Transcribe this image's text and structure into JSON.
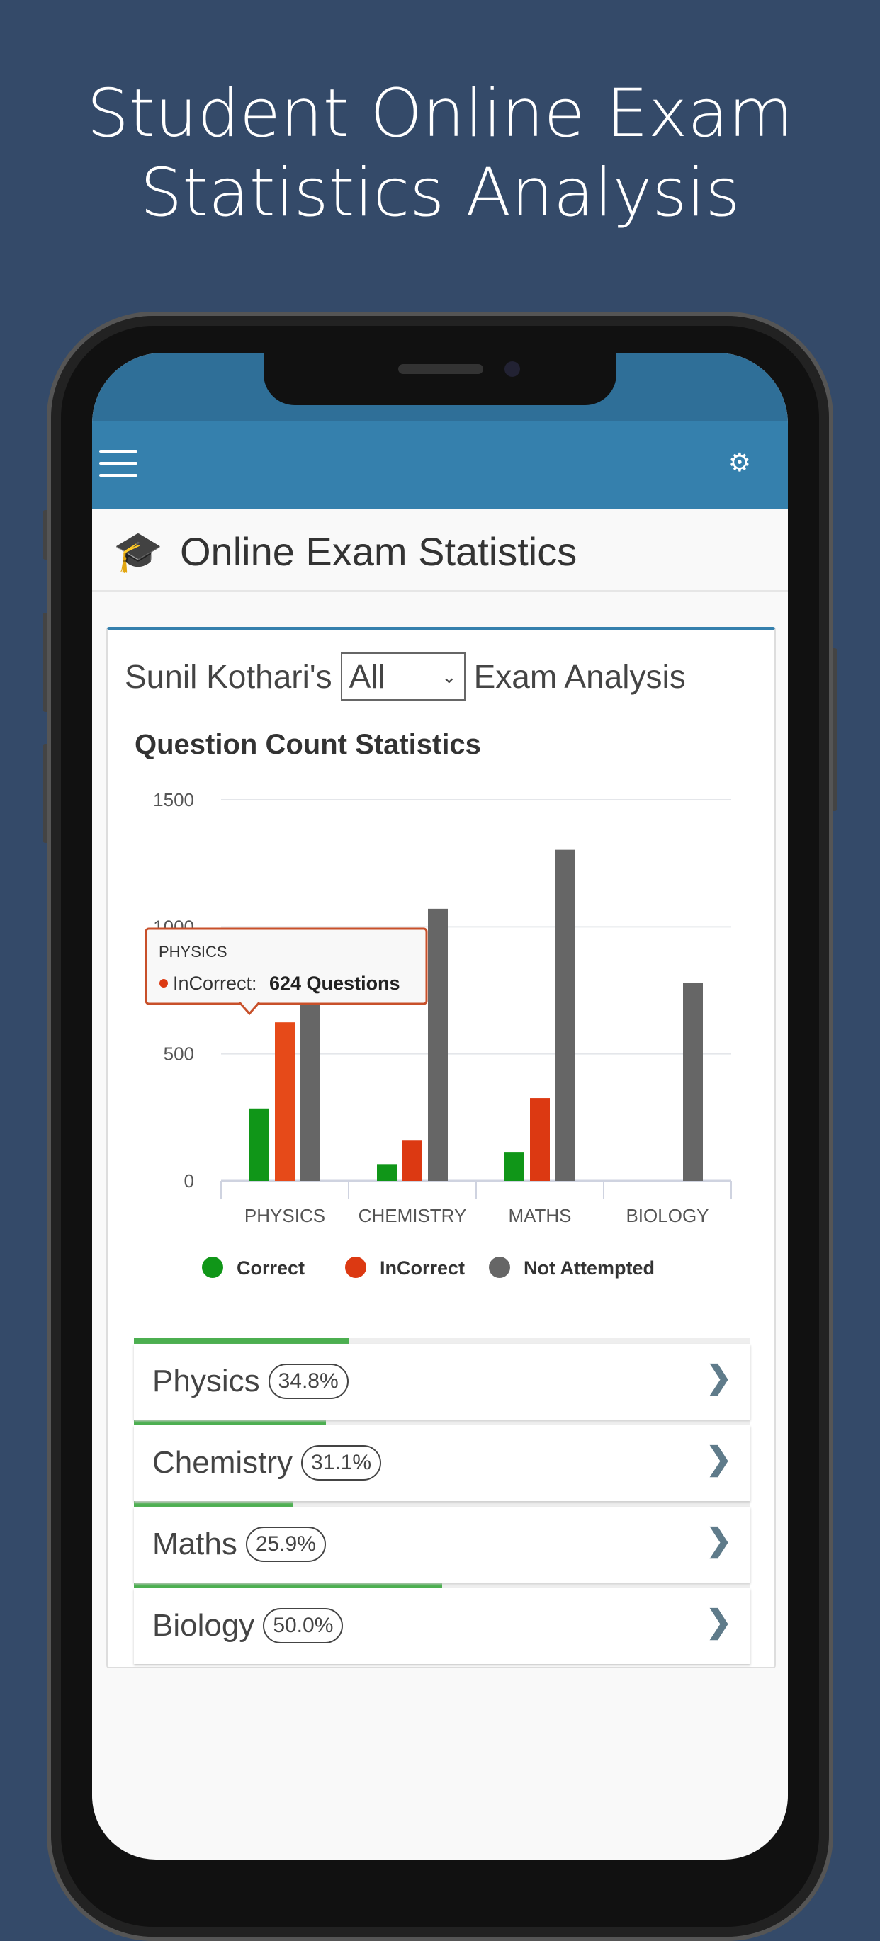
{
  "hero": {
    "line1": "Student Online Exam",
    "line2": "Statistics Analysis"
  },
  "toolbar": {
    "menu_icon": "hamburger-icon",
    "settings_icon": "gears-icon"
  },
  "page": {
    "title": "Online Exam Statistics",
    "icon": "graduation-cap-icon"
  },
  "analysis": {
    "prefix": "Sunil Kothari's",
    "select_value": "All",
    "suffix": "Exam Analysis"
  },
  "chart_data": {
    "type": "bar",
    "title": "Question Count Statistics",
    "categories": [
      "PHYSICS",
      "CHEMISTRY",
      "MATHS",
      "BIOLOGY"
    ],
    "ylim": [
      0,
      1500
    ],
    "yticks": [
      0,
      500,
      1000,
      1500
    ],
    "grid": true,
    "legend": "bottom",
    "series": [
      {
        "name": "Correct",
        "color": "#109618",
        "values": [
          285,
          66,
          114,
          0
        ]
      },
      {
        "name": "InCorrect",
        "color": "#dc3912",
        "values": [
          624,
          161,
          326,
          0
        ]
      },
      {
        "name": "Not Attempted",
        "color": "#666666",
        "values": [
          848,
          1071,
          1303,
          780
        ]
      }
    ],
    "tooltip": {
      "category": "PHYSICS",
      "series": "InCorrect:",
      "value": "624 Questions"
    }
  },
  "subjects": [
    {
      "name": "Physics",
      "percent": "34.8%",
      "progress": 34.8
    },
    {
      "name": "Chemistry",
      "percent": "31.1%",
      "progress": 31.1
    },
    {
      "name": "Maths",
      "percent": "25.9%",
      "progress": 25.9
    },
    {
      "name": "Biology",
      "percent": "50.0%",
      "progress": 50.0
    }
  ],
  "colors": {
    "toolbar": "#3580ad",
    "background": "#344a69",
    "progress": "#4caf50"
  }
}
